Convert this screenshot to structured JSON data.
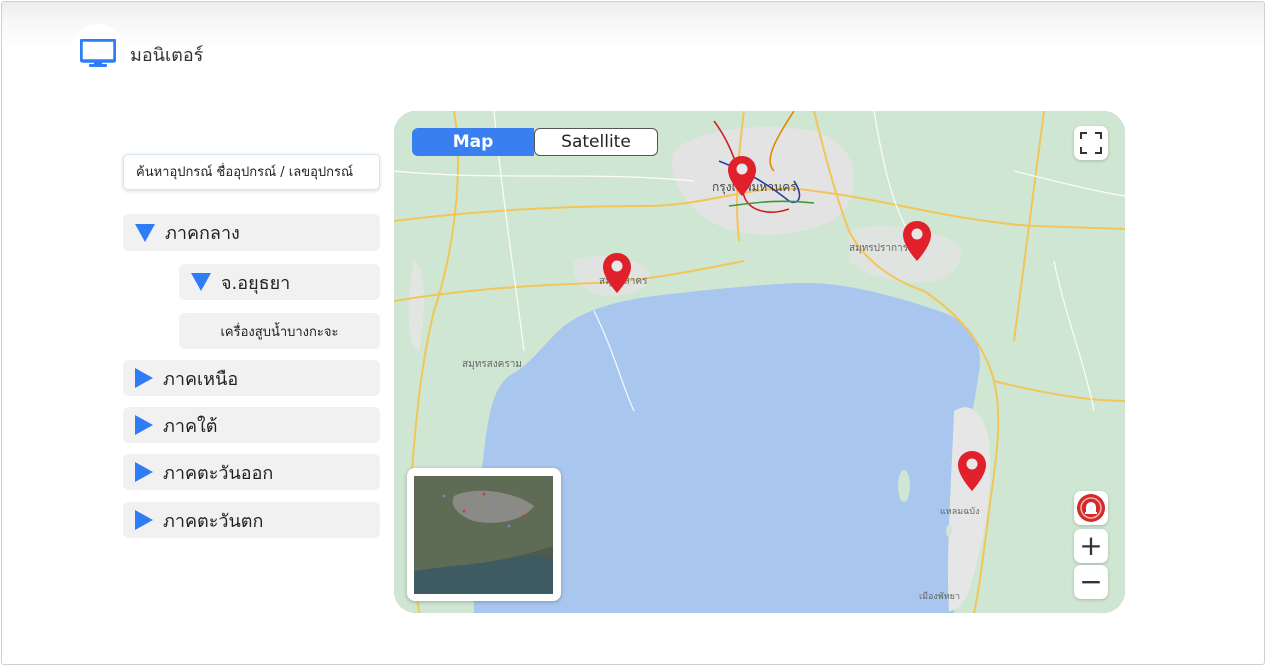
{
  "app": {
    "title": "มอนิเตอร์",
    "icon": "monitor-icon",
    "accent": "#2f7df6"
  },
  "search": {
    "placeholder": "ค้นหาอุปกรณ์ ชื่ออุปกรณ์ / เลขอุปกรณ์"
  },
  "tree": {
    "regions": [
      {
        "label": "ภาคกลาง",
        "expanded": true
      },
      {
        "label": "ภาคเหนือ",
        "expanded": false
      },
      {
        "label": "ภาคใต้",
        "expanded": false
      },
      {
        "label": "ภาคตะวันออก",
        "expanded": false
      },
      {
        "label": "ภาคตะวันตก",
        "expanded": false
      }
    ],
    "province": {
      "label": "จ.อยุธยา",
      "expanded": true
    },
    "device": {
      "label": "เครื่องสูบน้ำบางกะจะ"
    }
  },
  "map": {
    "toggle": {
      "map_label": "Map",
      "satellite_label": "Satellite",
      "selected": "Map"
    },
    "controls": {
      "fullscreen": "fullscreen-icon",
      "alarm": "alarm-icon",
      "zoom_in": "+",
      "zoom_out": "−"
    },
    "pin_color": "#e0202a",
    "water_color": "#a9c6ee",
    "land_color": "#cfe6d2",
    "place_labels": {
      "bangkok": "กรุงเทพมหานคร",
      "samut_prakan": "สมุทรปราการ",
      "samut_sakhon": "สมุทรสาคร",
      "samut_songkhram": "สมุทรสงคราม",
      "laem_chabang": "แหลมฉบัง",
      "pattaya": "เมืองพัทยา"
    }
  }
}
